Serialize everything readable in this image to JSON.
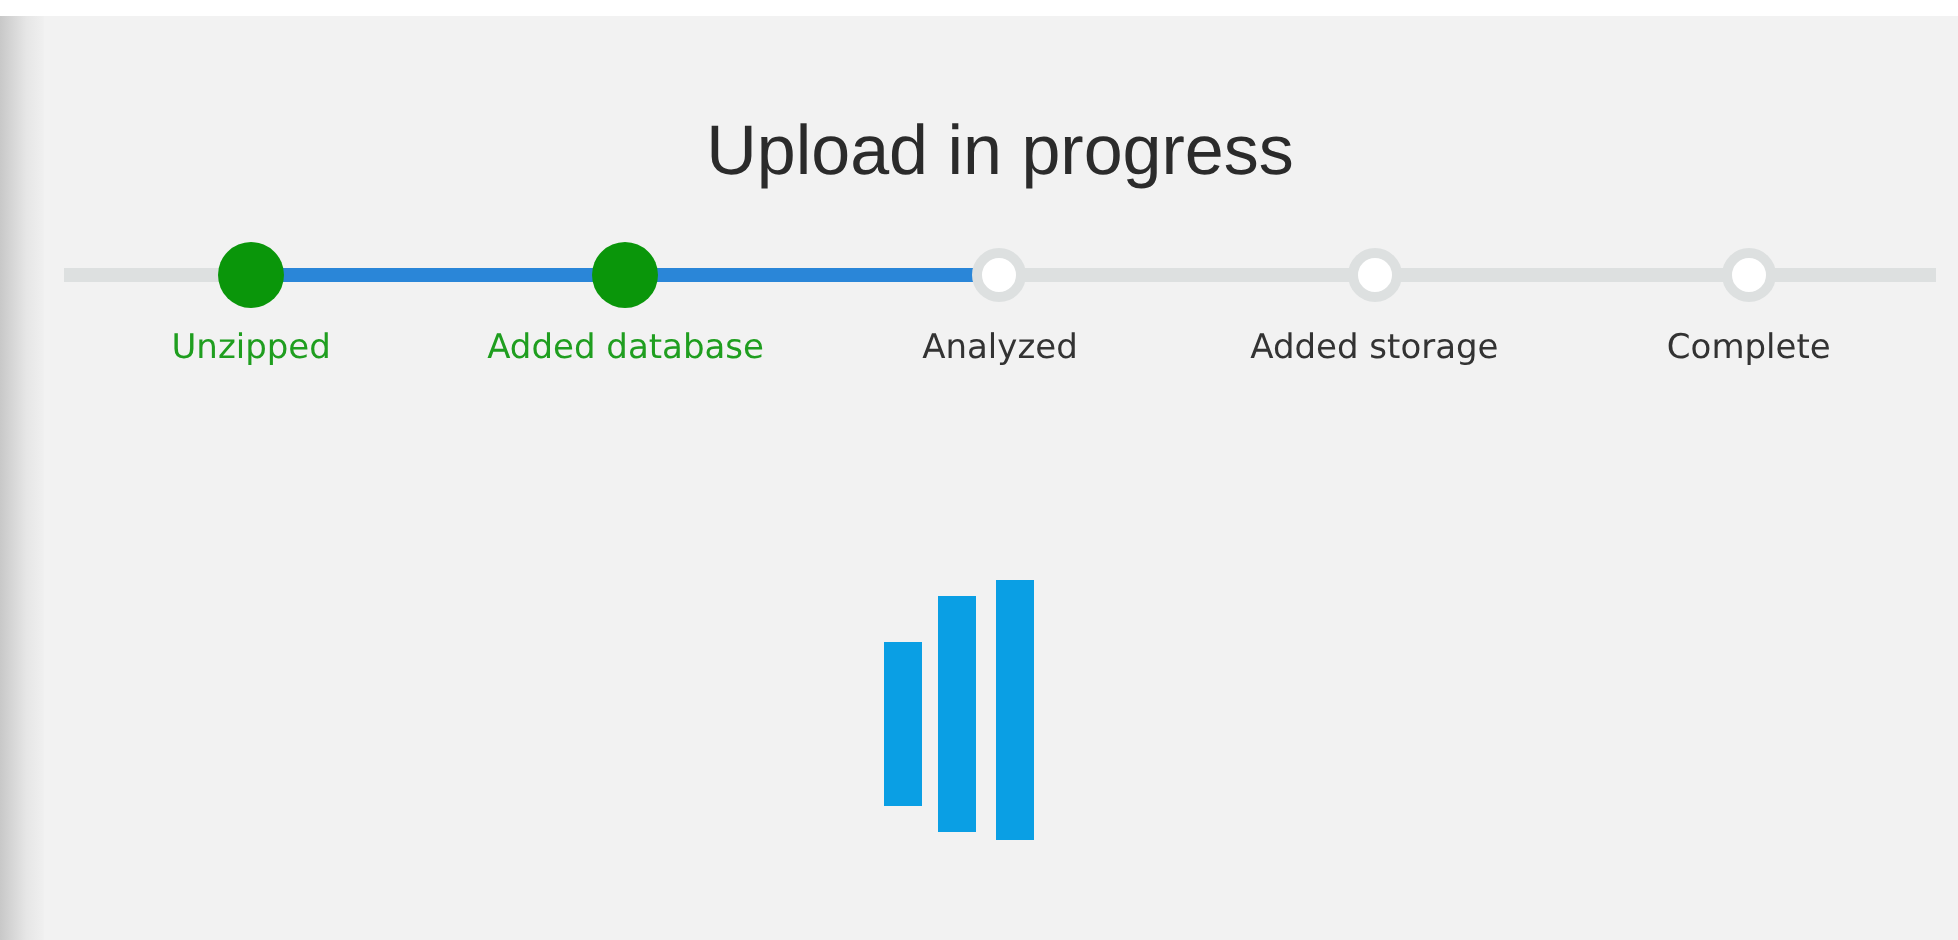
{
  "title": "Upload in progress",
  "steps": [
    {
      "label": "Unzipped",
      "completed": true
    },
    {
      "label": "Added database",
      "completed": true
    },
    {
      "label": "Analyzed",
      "completed": false
    },
    {
      "label": "Added storage",
      "completed": false
    },
    {
      "label": "Complete",
      "completed": false
    }
  ]
}
